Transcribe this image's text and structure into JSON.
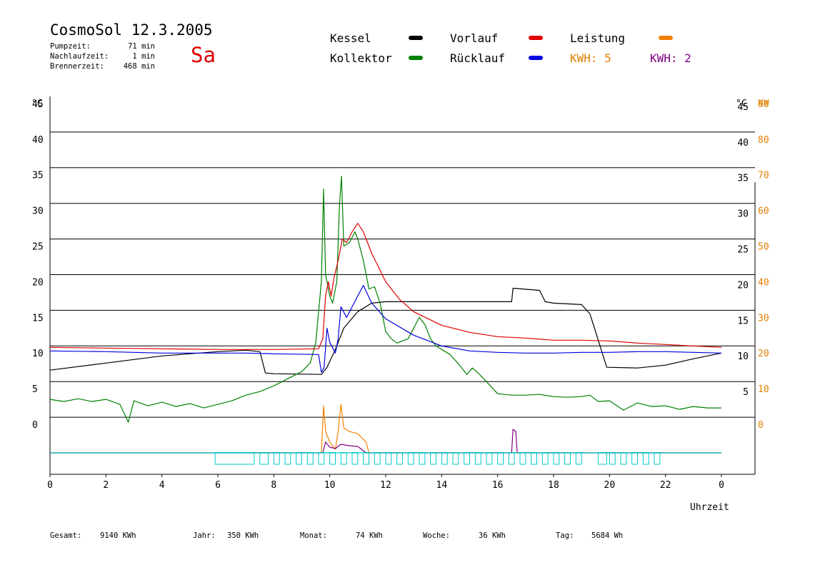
{
  "header": {
    "title": "CosmoSol 12.3.2005",
    "day": "Sa",
    "info": [
      {
        "label": "Pumpzeit:",
        "value": "71 min"
      },
      {
        "label": "Nachlaufzeit:",
        "value": "1 min"
      },
      {
        "label": "Brennerzeit:",
        "value": "468 min"
      }
    ]
  },
  "legend": {
    "kessel": {
      "label": "Kessel",
      "color": "#000000"
    },
    "kollektor": {
      "label": "Kollektor",
      "color": "#008000"
    },
    "vorlauf": {
      "label": "Vorlauf",
      "color": "#e00000"
    },
    "ruecklauf": {
      "label": "Rücklauf",
      "color": "#0000e0"
    },
    "leistung": {
      "label": "Leistung",
      "color": "#f08000"
    },
    "kwh1": {
      "label": "KWH: 5",
      "color": "#e08000"
    },
    "kwh2": {
      "label": "KWH: 2",
      "color": "#800080"
    }
  },
  "footer": {
    "gesamt_label": "Gesamt:",
    "gesamt_value": "9140 KWh",
    "jahr_label": "Jahr:",
    "jahr_value": "350 KWh",
    "monat_label": "Monat:",
    "monat_value": "74 KWh",
    "woche_label": "Woche:",
    "woche_value": "36 KWh",
    "tag_label": "Tag:",
    "tag_value": "5684 Wh"
  },
  "chart_data": {
    "type": "line",
    "xlabel": "Uhrzeit",
    "ylabel_left": "°C",
    "ylabel_right_1": "°C",
    "ylabel_right_2": "KW",
    "x_ticks": [
      "0",
      "2",
      "4",
      "6",
      "8",
      "10",
      "12",
      "14",
      "16",
      "18",
      "20",
      "22",
      "0"
    ],
    "y_ticks_left": [
      0,
      5,
      10,
      15,
      20,
      25,
      30,
      35,
      40,
      45
    ],
    "y_ticks_right_temp": [
      5,
      10,
      15,
      20,
      25,
      30,
      35,
      40,
      45
    ],
    "y_ticks_right_kw": [
      0,
      10,
      20,
      30,
      40,
      50,
      60,
      70,
      80,
      90
    ],
    "xlim": [
      0,
      24
    ],
    "ylim": [
      -3,
      50
    ],
    "grid": true,
    "series": [
      {
        "name": "Kessel",
        "color": "#000000",
        "points": [
          [
            0,
            11.6
          ],
          [
            2,
            12.6
          ],
          [
            4,
            13.6
          ],
          [
            6,
            14.2
          ],
          [
            7,
            14.4
          ],
          [
            7.5,
            14.2
          ],
          [
            7.7,
            11.2
          ],
          [
            8,
            11.1
          ],
          [
            9.7,
            11.0
          ],
          [
            9.9,
            12.0
          ],
          [
            10.2,
            14.5
          ],
          [
            10.5,
            17.5
          ],
          [
            11,
            19.8
          ],
          [
            11.5,
            21.0
          ],
          [
            12,
            21.2
          ],
          [
            14,
            21.2
          ],
          [
            16.5,
            21.2
          ],
          [
            16.55,
            23.1
          ],
          [
            17.5,
            22.8
          ],
          [
            17.7,
            21.2
          ],
          [
            18,
            21.0
          ],
          [
            19,
            20.8
          ],
          [
            19.3,
            19.5
          ],
          [
            19.5,
            17.0
          ],
          [
            19.9,
            12.0
          ],
          [
            21,
            11.9
          ],
          [
            22,
            12.3
          ],
          [
            23,
            13.2
          ],
          [
            24,
            14.0
          ]
        ]
      },
      {
        "name": "Kollektor",
        "color": "#008000",
        "points": [
          [
            0,
            7.5
          ],
          [
            0.5,
            7.2
          ],
          [
            1,
            7.6
          ],
          [
            1.5,
            7.2
          ],
          [
            2,
            7.5
          ],
          [
            2.5,
            6.8
          ],
          [
            2.8,
            4.3
          ],
          [
            3,
            7.3
          ],
          [
            3.5,
            6.6
          ],
          [
            4,
            7.1
          ],
          [
            4.5,
            6.5
          ],
          [
            5,
            6.9
          ],
          [
            5.5,
            6.3
          ],
          [
            6,
            6.8
          ],
          [
            6.5,
            7.3
          ],
          [
            7,
            8.1
          ],
          [
            7.5,
            8.6
          ],
          [
            8,
            9.4
          ],
          [
            8.5,
            10.4
          ],
          [
            9,
            11.4
          ],
          [
            9.3,
            12.6
          ],
          [
            9.5,
            15.5
          ],
          [
            9.7,
            24.0
          ],
          [
            9.78,
            37.0
          ],
          [
            9.85,
            25.0
          ],
          [
            10.0,
            22.0
          ],
          [
            10.1,
            21.0
          ],
          [
            10.25,
            24.0
          ],
          [
            10.35,
            35.0
          ],
          [
            10.42,
            38.8
          ],
          [
            10.5,
            29.0
          ],
          [
            10.7,
            29.5
          ],
          [
            10.9,
            31.0
          ],
          [
            11.0,
            30.0
          ],
          [
            11.2,
            27.0
          ],
          [
            11.4,
            23.0
          ],
          [
            11.6,
            23.3
          ],
          [
            11.8,
            21.0
          ],
          [
            12.0,
            17.0
          ],
          [
            12.2,
            16.0
          ],
          [
            12.4,
            15.4
          ],
          [
            12.6,
            15.7
          ],
          [
            12.8,
            16.0
          ],
          [
            13.0,
            17.5
          ],
          [
            13.2,
            19.0
          ],
          [
            13.4,
            18.0
          ],
          [
            13.6,
            16.0
          ],
          [
            13.8,
            15.0
          ],
          [
            14.0,
            14.5
          ],
          [
            14.3,
            13.8
          ],
          [
            14.6,
            12.5
          ],
          [
            14.9,
            11.0
          ],
          [
            15.1,
            11.9
          ],
          [
            15.3,
            11.2
          ],
          [
            15.6,
            10.0
          ],
          [
            16.0,
            8.3
          ],
          [
            16.5,
            8.1
          ],
          [
            17,
            8.1
          ],
          [
            17.5,
            8.2
          ],
          [
            18,
            7.9
          ],
          [
            18.5,
            7.8
          ],
          [
            19,
            7.9
          ],
          [
            19.3,
            8.1
          ],
          [
            19.6,
            7.2
          ],
          [
            20,
            7.3
          ],
          [
            20.5,
            6.0
          ],
          [
            21,
            7.0
          ],
          [
            21.5,
            6.5
          ],
          [
            22,
            6.6
          ],
          [
            22.5,
            6.1
          ],
          [
            23,
            6.5
          ],
          [
            23.5,
            6.3
          ],
          [
            24,
            6.3
          ]
        ]
      },
      {
        "name": "Vorlauf",
        "color": "#e00000",
        "points": [
          [
            0,
            14.8
          ],
          [
            2,
            14.7
          ],
          [
            4,
            14.6
          ],
          [
            6,
            14.5
          ],
          [
            8,
            14.5
          ],
          [
            9.6,
            14.6
          ],
          [
            9.75,
            16.0
          ],
          [
            9.85,
            22.0
          ],
          [
            9.95,
            24.0
          ],
          [
            10.05,
            22.0
          ],
          [
            10.15,
            24.5
          ],
          [
            10.3,
            27.0
          ],
          [
            10.45,
            30.0
          ],
          [
            10.6,
            29.5
          ],
          [
            10.8,
            31.0
          ],
          [
            11.0,
            32.2
          ],
          [
            11.2,
            31.0
          ],
          [
            11.5,
            28.0
          ],
          [
            12.0,
            24.0
          ],
          [
            12.5,
            21.5
          ],
          [
            13,
            19.8
          ],
          [
            14,
            17.9
          ],
          [
            15,
            16.9
          ],
          [
            16,
            16.3
          ],
          [
            17,
            16.1
          ],
          [
            18,
            15.8
          ],
          [
            19,
            15.8
          ],
          [
            20,
            15.7
          ],
          [
            21,
            15.4
          ],
          [
            22,
            15.2
          ],
          [
            23,
            15.0
          ],
          [
            24,
            14.8
          ]
        ]
      },
      {
        "name": "Rücklauf",
        "color": "#0000e0",
        "points": [
          [
            0,
            14.3
          ],
          [
            2,
            14.2
          ],
          [
            4,
            14.0
          ],
          [
            6,
            14.0
          ],
          [
            7,
            14.0
          ],
          [
            8,
            13.9
          ],
          [
            9.6,
            13.8
          ],
          [
            9.7,
            11.3
          ],
          [
            9.8,
            12.0
          ],
          [
            9.9,
            17.5
          ],
          [
            10.0,
            15.5
          ],
          [
            10.2,
            14.0
          ],
          [
            10.3,
            16.0
          ],
          [
            10.4,
            20.5
          ],
          [
            10.6,
            19.0
          ],
          [
            10.8,
            20.5
          ],
          [
            11.0,
            22.0
          ],
          [
            11.2,
            23.5
          ],
          [
            11.5,
            21.0
          ],
          [
            12,
            18.8
          ],
          [
            13,
            16.5
          ],
          [
            14,
            15.0
          ],
          [
            15,
            14.3
          ],
          [
            16,
            14.1
          ],
          [
            17,
            14.0
          ],
          [
            18,
            14.0
          ],
          [
            19,
            14.1
          ],
          [
            20,
            14.1
          ],
          [
            21,
            14.2
          ],
          [
            22,
            14.2
          ],
          [
            23,
            14.1
          ],
          [
            24,
            14.0
          ]
        ]
      },
      {
        "name": "Leistung",
        "color": "#f08000",
        "points": [
          [
            0,
            0
          ],
          [
            9.7,
            0
          ],
          [
            9.78,
            6.6
          ],
          [
            9.85,
            3.0
          ],
          [
            10.0,
            1.5
          ],
          [
            10.2,
            0.5
          ],
          [
            10.3,
            3.0
          ],
          [
            10.4,
            6.8
          ],
          [
            10.5,
            3.5
          ],
          [
            10.7,
            3.0
          ],
          [
            11.0,
            2.7
          ],
          [
            11.3,
            1.5
          ],
          [
            11.4,
            0
          ],
          [
            24,
            0
          ]
        ]
      },
      {
        "name": "KWH2",
        "color": "#800080",
        "points": [
          [
            0,
            0
          ],
          [
            9.75,
            0
          ],
          [
            9.85,
            1.5
          ],
          [
            10.0,
            0.8
          ],
          [
            10.2,
            0.6
          ],
          [
            10.4,
            1.2
          ],
          [
            10.7,
            1.0
          ],
          [
            11.0,
            0.9
          ],
          [
            11.2,
            0.3
          ],
          [
            11.3,
            0
          ],
          [
            16.5,
            0
          ],
          [
            16.55,
            3.3
          ],
          [
            16.65,
            3.0
          ],
          [
            16.7,
            0
          ],
          [
            24,
            0
          ]
        ]
      },
      {
        "name": "Pumpe",
        "color": "#00c8c8",
        "points": [
          [
            0,
            0
          ],
          [
            24,
            0
          ]
        ]
      }
    ],
    "pump_blocks": [
      [
        5.9,
        7.3
      ],
      [
        7.5,
        7.8
      ],
      [
        8.0,
        8.2
      ],
      [
        8.4,
        8.6
      ],
      [
        8.8,
        9.0
      ],
      [
        9.2,
        9.4
      ],
      [
        9.6,
        9.8
      ],
      [
        10.0,
        10.2
      ],
      [
        10.4,
        10.6
      ],
      [
        10.8,
        11.0
      ],
      [
        11.2,
        11.4
      ],
      [
        11.6,
        11.8
      ],
      [
        12.0,
        12.2
      ],
      [
        12.4,
        12.6
      ],
      [
        12.8,
        13.0
      ],
      [
        13.2,
        13.4
      ],
      [
        13.6,
        13.8
      ],
      [
        14.0,
        14.2
      ],
      [
        14.4,
        14.6
      ],
      [
        14.8,
        15.0
      ],
      [
        15.2,
        15.4
      ],
      [
        15.6,
        15.8
      ],
      [
        16.0,
        16.2
      ],
      [
        16.4,
        16.6
      ],
      [
        16.8,
        17.0
      ],
      [
        17.2,
        17.4
      ],
      [
        17.6,
        17.8
      ],
      [
        18.0,
        18.2
      ],
      [
        18.4,
        18.6
      ],
      [
        18.8,
        19.0
      ],
      [
        19.6,
        19.9
      ],
      [
        20.0,
        20.2
      ],
      [
        20.4,
        20.6
      ],
      [
        20.8,
        21.0
      ],
      [
        21.2,
        21.4
      ],
      [
        21.6,
        21.8
      ]
    ]
  }
}
